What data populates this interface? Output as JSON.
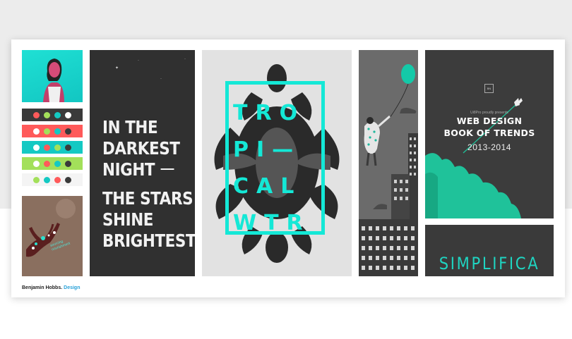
{
  "colors": {
    "accent_teal": "#14e8d6",
    "dark_tile": "#303030",
    "footer_accent": "#2aa1d8"
  },
  "night": {
    "line1": "IN THE",
    "line2": "DARKEST",
    "line3": "NIGHT",
    "line4": "THE STARS",
    "line5": "SHINE",
    "line6": "BRIGHTEST"
  },
  "tropical": {
    "rows": [
      "TRO",
      "PI—",
      "CAL",
      "WTR"
    ]
  },
  "tree": {
    "label": "sourcing nourishment"
  },
  "webdesign": {
    "badge": "BN",
    "presents": "Ui8Pro proudly presents",
    "title_line1": "WEB DESIGN",
    "title_line2": "BOOK OF TRENDS",
    "years": "2013-2014"
  },
  "simplifica": {
    "text": "SIMPLIFICA"
  },
  "footer": {
    "name": "Benjamin Hobbs.",
    "accent": "Design"
  },
  "palette": {
    "rows": [
      {
        "bg": "#3a3a3a",
        "dots": [
          "#ff5a5a",
          "#a3e05a",
          "#14c9c3",
          "#ffffff"
        ]
      },
      {
        "bg": "#ff5a5a",
        "dots": [
          "#ffffff",
          "#a3e05a",
          "#14c9c3",
          "#3a3a3a"
        ]
      },
      {
        "bg": "#14c9c3",
        "dots": [
          "#ffffff",
          "#ff5a5a",
          "#a3e05a",
          "#3a3a3a"
        ]
      },
      {
        "bg": "#a3e05a",
        "dots": [
          "#ffffff",
          "#ff5a5a",
          "#14c9c3",
          "#3a3a3a"
        ]
      },
      {
        "bg": "#f4f4f4",
        "dots": [
          "#a3e05a",
          "#14c9c3",
          "#ff5a5a",
          "#3a3a3a"
        ]
      }
    ]
  }
}
